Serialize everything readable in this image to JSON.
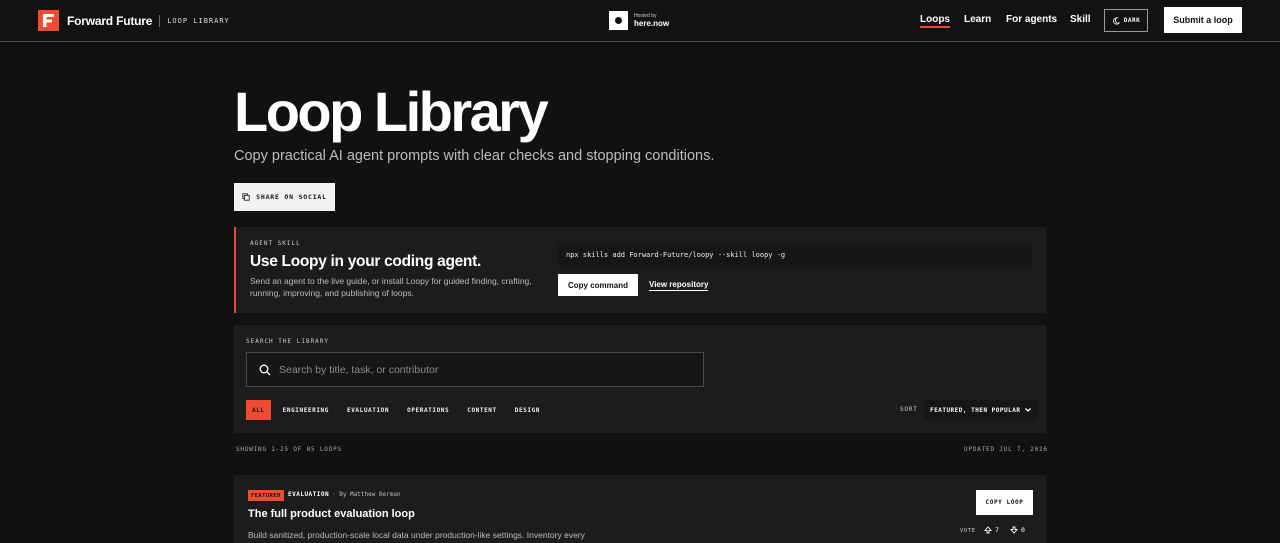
{
  "header": {
    "brand_name": "Forward Future",
    "brand_sub": "LOOP LIBRARY",
    "hosted_small": "Hosted by",
    "hosted_name": "here.now",
    "nav": [
      "Loops",
      "Learn",
      "For agents",
      "Skill"
    ],
    "theme_label": "DARK",
    "submit_label": "Submit a loop"
  },
  "hero": {
    "title": "Loop Library",
    "subtitle": "Copy practical AI agent prompts with clear checks and stopping conditions.",
    "share_label": "SHARE ON SOCIAL"
  },
  "skill": {
    "kicker": "AGENT SKILL",
    "title": "Use Loopy in your coding agent.",
    "description": "Send an agent to the live guide, or install Loopy for guided finding, crafting, running, improving, and publishing of loops.",
    "command": "npx skills add Forward-Future/loopy --skill loopy -g",
    "copy_label": "Copy command",
    "repo_label": "View repository"
  },
  "search": {
    "kicker": "SEARCH THE LIBRARY",
    "placeholder": "Search by title, task, or contributor",
    "filters": [
      "ALL",
      "ENGINEERING",
      "EVALUATION",
      "OPERATIONS",
      "CONTENT",
      "DESIGN"
    ],
    "sort_label": "SORT",
    "sort_value": "FEATURED, THEN POPULAR"
  },
  "results": {
    "showing": "SHOWING 1-25 OF 85 LOOPS",
    "updated": "UPDATED JUL 7, 2026"
  },
  "card": {
    "badge": "FEATURED",
    "category": "EVALUATION",
    "byline": "· By Matthew Berman",
    "title": "The full product evaluation loop",
    "description": "Build sanitized, production-scale local data under production-like settings. Inventory every",
    "copy_label": "COPY LOOP",
    "vote_label": "VOTE",
    "upvotes": "7",
    "downvotes": "0"
  },
  "colors": {
    "accent": "#ef4b31",
    "background": "#111111",
    "panel": "#1c1c1c"
  }
}
